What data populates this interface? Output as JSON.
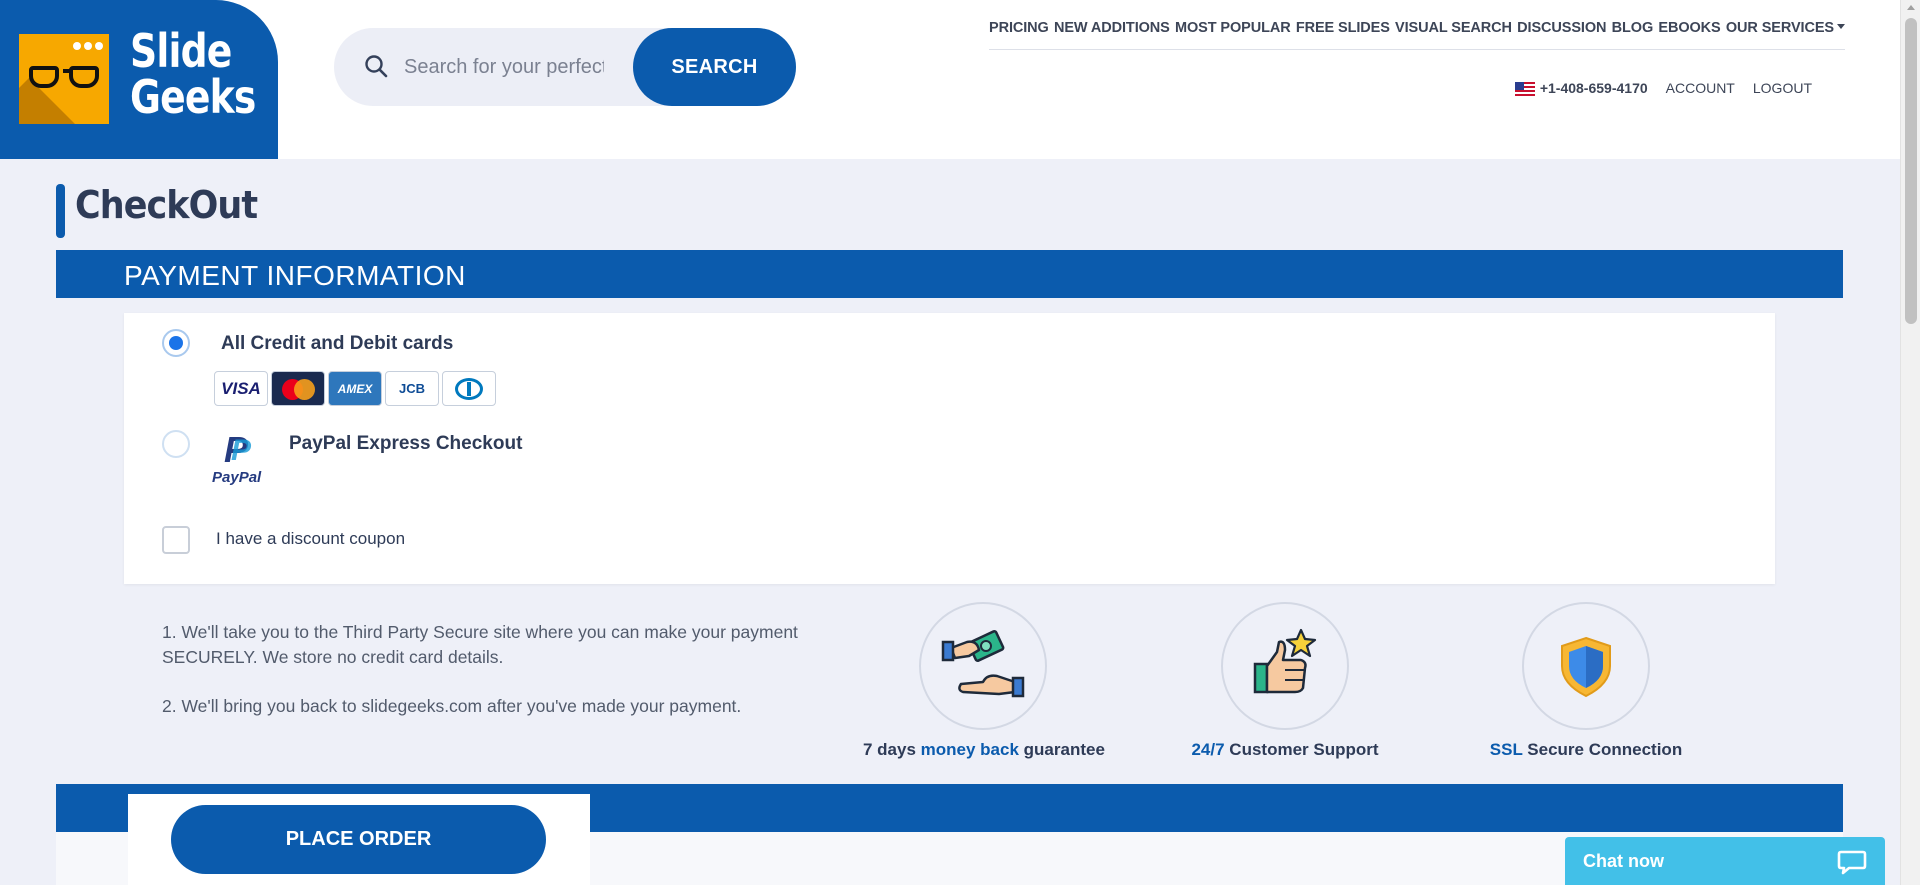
{
  "brand": {
    "line1": "Slide",
    "line2": "Geeks",
    "color": "#0b5bad",
    "accent": "#f7a800"
  },
  "search": {
    "placeholder": "Search for your perfect presentation",
    "button_label": "SEARCH"
  },
  "nav": {
    "items": [
      "PRICING",
      "NEW ADDITIONS",
      "MOST POPULAR",
      "FREE SLIDES",
      "VISUAL SEARCH",
      "DISCUSSION",
      "BLOG",
      "EBOOKS",
      "OUR SERVICES"
    ]
  },
  "account_bar": {
    "phone": "+1-408-659-4170",
    "account_label": "ACCOUNT",
    "logout_label": "LOGOUT",
    "flag_icon": "us-flag-icon"
  },
  "page": {
    "title": "CheckOut"
  },
  "payment": {
    "section_title": "PAYMENT INFORMATION",
    "options": [
      {
        "label": "All Credit and Debit cards",
        "selected": true
      },
      {
        "label": "PayPal Express Checkout",
        "selected": false
      }
    ],
    "card_logos": [
      "VISA",
      "MasterCard",
      "AMEX",
      "JCB",
      "Diners Club"
    ],
    "paypal_wordmark": "PayPal",
    "coupon_label": "I have a discount coupon",
    "coupon_checked": false
  },
  "notes": [
    "1. We'll take you to the Third Party Secure site where you can make your payment SECURELY. We store no credit card details.",
    "2. We'll bring you back to slidegeeks.com after you've made your payment."
  ],
  "badges": [
    {
      "icon": "money-exchange-icon",
      "pre": "7 days ",
      "highlight": "money back",
      "post": " guarantee"
    },
    {
      "icon": "thumbs-up-star-icon",
      "pre": "",
      "highlight": "24/7",
      "post": " Customer Support"
    },
    {
      "icon": "shield-icon",
      "pre": "",
      "highlight": "SSL",
      "post": " Secure Connection"
    }
  ],
  "order": {
    "button_label": "PLACE ORDER"
  },
  "chat": {
    "label": "Chat now",
    "icon": "chat-bubble-icon"
  }
}
